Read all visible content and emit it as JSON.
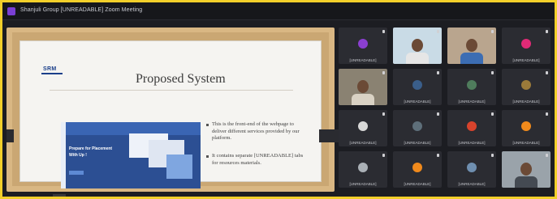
{
  "window": {
    "title": "Shanjuli Group [UNREADABLE] Zoom Meeting",
    "brand_color": "#7a3fd4"
  },
  "slide": {
    "logo_text": "SRM",
    "title": "Proposed System",
    "image_line1": "Prepare for Placement",
    "image_line2": "With Up !",
    "bullets": [
      "This is the front-end of the webpage to deliver different services provided by our platform.",
      "It contains separate [UNREADABLE] tabs for resources materials."
    ]
  },
  "participants": [
    {
      "name": "[UNREADABLE]",
      "avatar_color": "#8b3fd1",
      "kind": "avatar"
    },
    {
      "name": "",
      "kind": "video",
      "shirt": "#e6e6e6",
      "bg": "#c9dbe6"
    },
    {
      "name": "",
      "kind": "video",
      "shirt": "#3c6db3",
      "bg": "#b9a58e"
    },
    {
      "name": "[UNREADABLE]",
      "avatar_color": "#e02a76",
      "kind": "avatar"
    },
    {
      "name": "",
      "kind": "video",
      "shirt": "#d9d2c4",
      "bg": "#8a8272"
    },
    {
      "name": "[UNREADABLE]",
      "avatar_color": "#3a5e8a",
      "kind": "avatar"
    },
    {
      "name": "[UNREADABLE]",
      "avatar_color": "#4f7c5c",
      "kind": "avatar"
    },
    {
      "name": "[UNREADABLE]",
      "avatar_color": "#9a7a3a",
      "kind": "avatar"
    },
    {
      "name": "[UNREADABLE]",
      "avatar_color": "#d8d8d8",
      "kind": "avatar"
    },
    {
      "name": "[UNREADABLE]",
      "avatar_color": "#5e6f7a",
      "kind": "avatar"
    },
    {
      "name": "[UNREADABLE]",
      "avatar_color": "#d8432c",
      "kind": "avatar"
    },
    {
      "name": "[UNREADABLE]",
      "avatar_color": "#f08a1c",
      "kind": "avatar"
    },
    {
      "name": "[UNREADABLE]",
      "avatar_color": "#aab0b6",
      "kind": "avatar"
    },
    {
      "name": "[UNREADABLE]",
      "avatar_color": "#f08a1c",
      "kind": "avatar"
    },
    {
      "name": "[UNREADABLE]",
      "avatar_color": "#6f8fb0",
      "kind": "avatar"
    },
    {
      "name": "",
      "kind": "video",
      "shirt": "#444a52",
      "bg": "#9aa3aa"
    }
  ]
}
